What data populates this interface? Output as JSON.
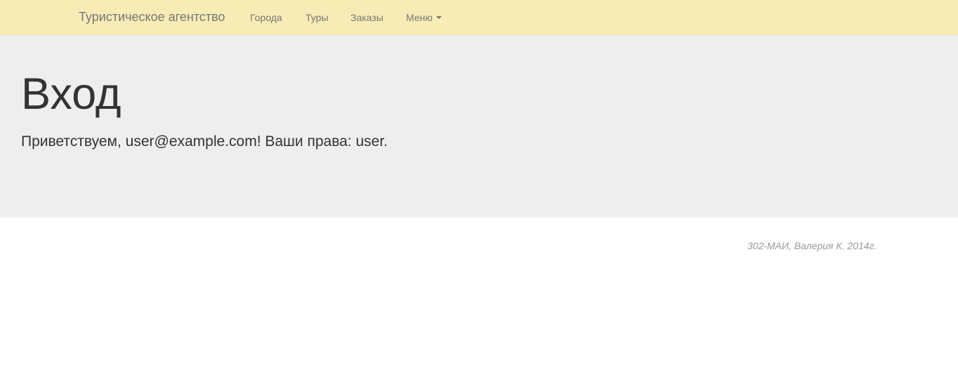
{
  "navbar": {
    "brand": "Туристическое агентство",
    "links": {
      "cities": "Города",
      "tours": "Туры",
      "orders": "Заказы",
      "menu": "Меню"
    }
  },
  "jumbotron": {
    "title": "Вход",
    "greeting": "Приветствуем, user@example.com! Ваши права: user."
  },
  "footer": {
    "note": "302-МАИ, Валерия К. 2014г."
  },
  "colors": {
    "navbar_bg": "#f8ecb6",
    "jumbotron_bg": "#eeeeee",
    "nav_text": "#777777",
    "footer_text": "#999999"
  }
}
